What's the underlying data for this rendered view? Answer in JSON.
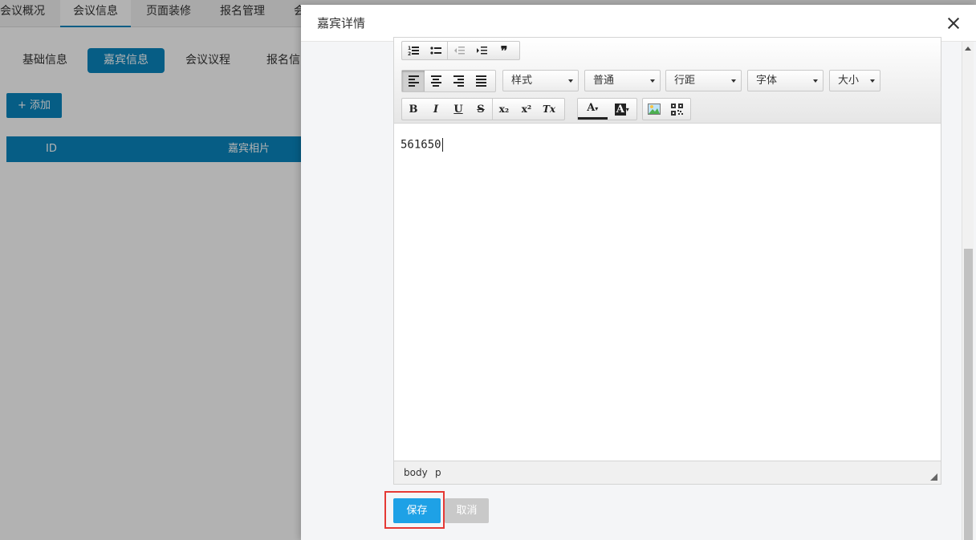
{
  "background": {
    "top_tabs": [
      "会议概况",
      "会议信息",
      "页面装修",
      "报名管理",
      "会"
    ],
    "active_top_tab": 1,
    "sub_tabs": [
      "基础信息",
      "嘉宾信息",
      "会议议程",
      "报名信"
    ],
    "active_sub_tab": 1,
    "add_button": "+ 添加",
    "table_headers": [
      "ID",
      "嘉宾相片"
    ]
  },
  "dialog": {
    "title": "嘉宾详情",
    "close_icon": "close-icon",
    "toolbar": {
      "row1": [
        "ordered-list-icon",
        "unordered-list-icon",
        "outdent-icon",
        "indent-icon",
        "blockquote-icon"
      ],
      "align": [
        "align-left-icon",
        "align-center-icon",
        "align-right-icon",
        "align-justify-icon"
      ],
      "selects": {
        "style": "样式",
        "paragraph": "普通",
        "line_height": "行距",
        "font": "字体",
        "size": "大小"
      },
      "format": {
        "bold": "B",
        "italic": "I",
        "underline": "U",
        "strike": "S",
        "subscript": "x₂",
        "superscript": "x²",
        "remove_format": "Tx"
      },
      "color": {
        "font_color": "A",
        "bg_color": "A"
      },
      "media": [
        "image-icon",
        "qrcode-icon"
      ]
    },
    "content": "561650",
    "path": [
      "body",
      "p"
    ],
    "save_label": "保存",
    "cancel_label": "取消"
  }
}
